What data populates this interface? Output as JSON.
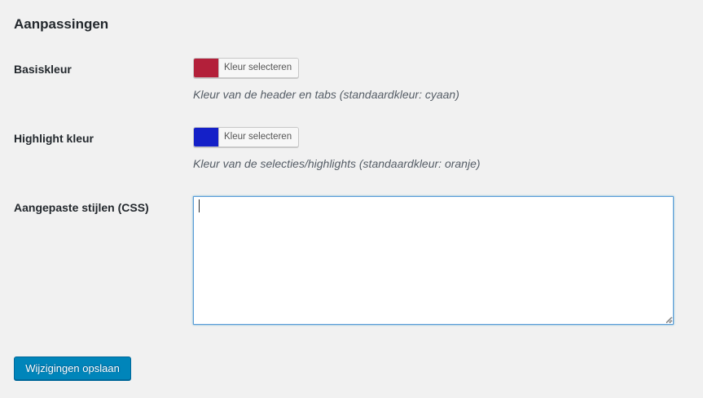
{
  "section": {
    "title": "Aanpassingen"
  },
  "settings": [
    {
      "label": "Basiskleur",
      "button_label": "Kleur selecteren",
      "color": "#b3203a",
      "description": "Kleur van de header en tabs (standaardkleur: cyaan)"
    },
    {
      "label": "Highlight kleur",
      "button_label": "Kleur selecteren",
      "color": "#1420c8",
      "description": "Kleur van de selecties/highlights (standaardkleur: oranje)"
    }
  ],
  "custom_css": {
    "label": "Aangepaste stijlen (CSS)",
    "value": ""
  },
  "actions": {
    "save_label": "Wijzigingen opslaan"
  },
  "colors": {
    "primary_button": "#0085ba",
    "focus_border": "#5b9dd9"
  }
}
